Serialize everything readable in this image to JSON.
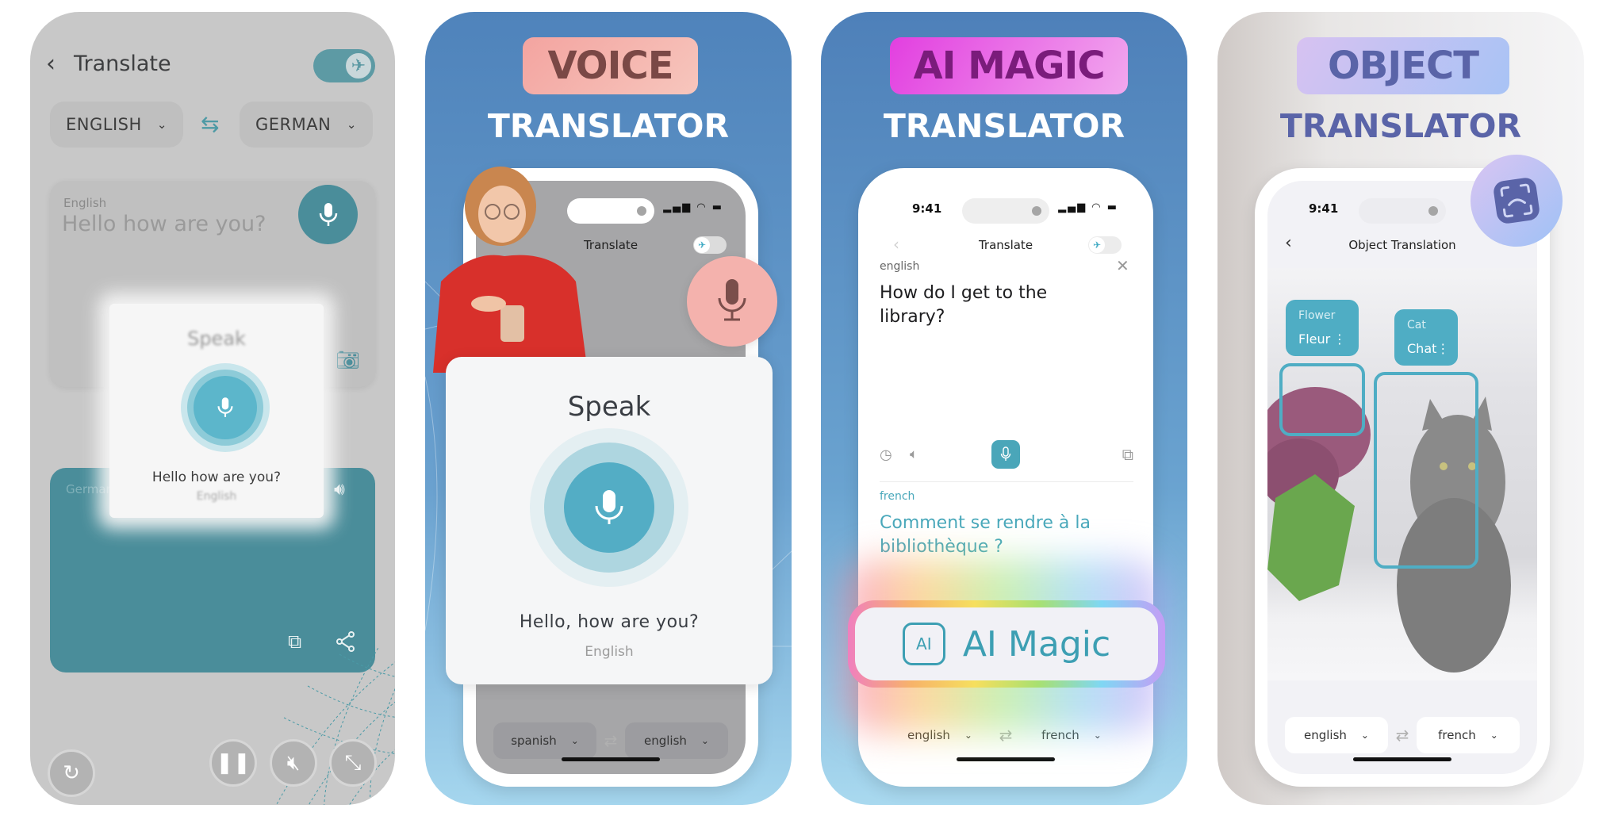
{
  "colors": {
    "teal_accent": "#4a8d9a",
    "light_teal": "#4fadc4",
    "voice_badge": "#f3a4a0",
    "ai_magic_badge": "#e23fe0",
    "object_badge": "#a8c3f5",
    "object_text": "#5a64a8",
    "sky_blue": "#4f83bb"
  },
  "panel1": {
    "header": {
      "back_icon": "chevron-left",
      "title": "Translate",
      "offline_toggle_icon": "airplane",
      "offline_toggle_on": true
    },
    "source_language": "ENGLISH",
    "target_language": "GERMAN",
    "swap_icon": "swap-arrows",
    "input": {
      "label": "English",
      "placeholder": "Hello how are you?"
    },
    "output": {
      "label": "German"
    },
    "speak_overlay": {
      "title": "Speak",
      "recognized_text": "Hello how are you?",
      "language": "English"
    },
    "controls": [
      "replay",
      "pause",
      "mute",
      "expand"
    ]
  },
  "panel2": {
    "badge": "VOICE",
    "subtitle": "TRANSLATOR",
    "phone": {
      "title": "Translate",
      "speak_card": {
        "title": "Speak",
        "recognized_text": "Hello, how are you?",
        "language": "English"
      },
      "source_language": "spanish",
      "target_language": "english"
    }
  },
  "panel3": {
    "badge": "AI MAGIC",
    "subtitle": "TRANSLATOR",
    "phone": {
      "time": "9:41",
      "title": "Translate",
      "source_label": "english",
      "source_text": "How do I get to the library?",
      "target_label": "french",
      "target_text": "Comment se rendre à la bibliothèque ?",
      "source_language": "english",
      "target_language": "french"
    },
    "ai_button": {
      "icon_text": "AI",
      "label": "AI Magic"
    }
  },
  "panel4": {
    "badge": "OBJECT",
    "subtitle": "TRANSLATOR",
    "phone": {
      "time": "9:41",
      "title": "Object Translation",
      "detections": [
        {
          "source": "Flower",
          "translation": "Fleur"
        },
        {
          "source": "Cat",
          "translation": "Chat"
        }
      ],
      "source_language": "english",
      "target_language": "french"
    }
  }
}
